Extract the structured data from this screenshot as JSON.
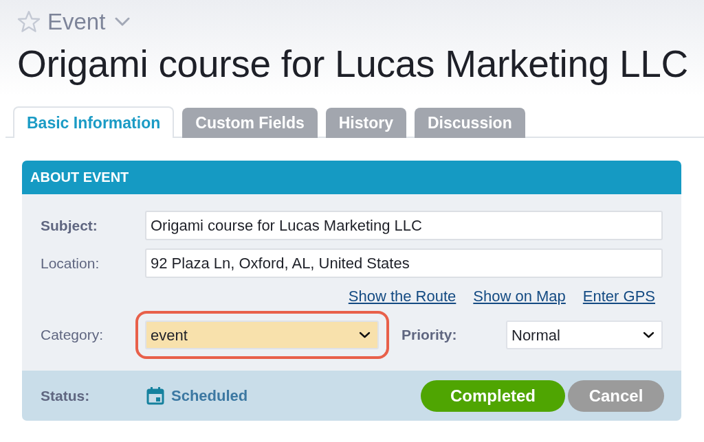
{
  "header": {
    "record_type": "Event",
    "starred": false,
    "title": "Origami course for Lucas Marketing LLC"
  },
  "tabs": [
    {
      "label": "Basic Information",
      "selected": true
    },
    {
      "label": "Custom Fields",
      "selected": false
    },
    {
      "label": "History",
      "selected": false
    },
    {
      "label": "Discussion",
      "selected": false
    }
  ],
  "panel": {
    "title": "ABOUT EVENT",
    "text_fields": [
      {
        "label": "Subject:",
        "required": true,
        "value": "Origami course for Lucas Marketing LLC"
      },
      {
        "label": "Location:",
        "required": false,
        "value": "92 Plaza Ln, Oxford, AL, United States"
      }
    ],
    "links": [
      "Show the Route",
      "Show on Map",
      "Enter GPS"
    ],
    "selects": [
      {
        "label": "Category:",
        "required": false,
        "value": "event",
        "color": "#f8e1ac",
        "highlighted": true
      },
      {
        "label": "Priority:",
        "required": true,
        "value": "Normal",
        "highlighted": false
      }
    ],
    "status": {
      "label": "Status:",
      "value": "Scheduled"
    },
    "buttons": [
      {
        "label": "Completed",
        "kind": "primary"
      },
      {
        "label": "Cancel",
        "kind": "secondary"
      }
    ]
  }
}
